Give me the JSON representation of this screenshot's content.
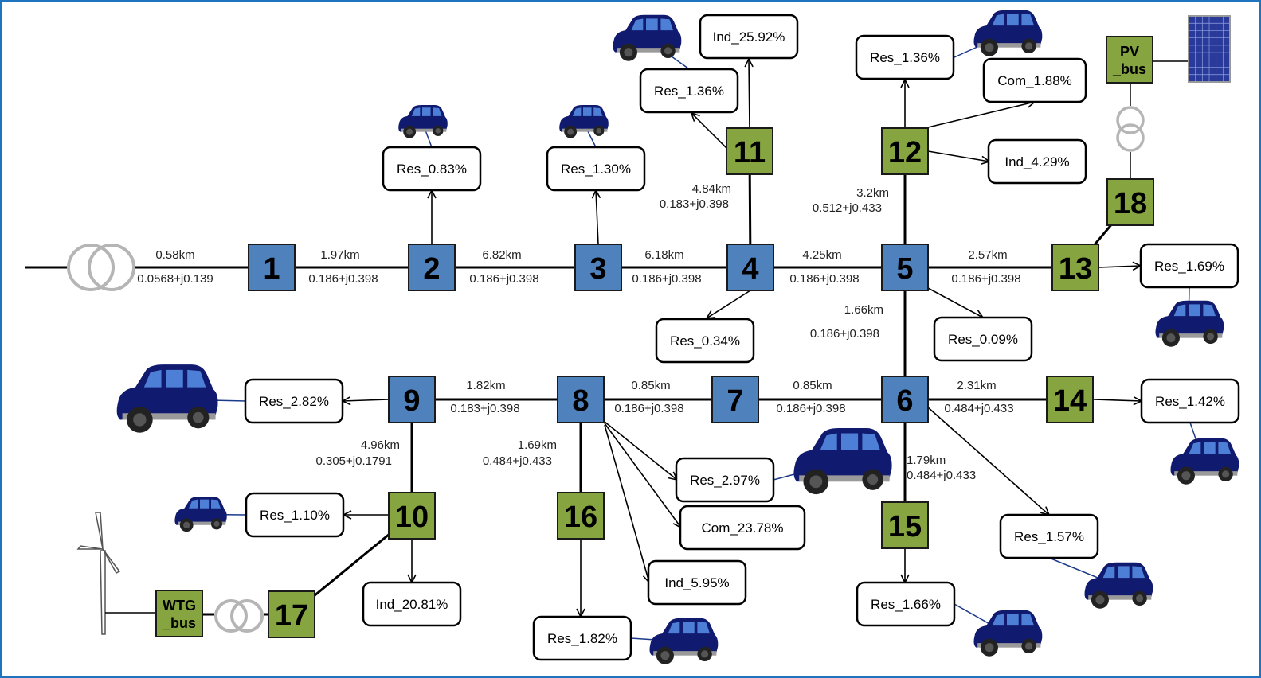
{
  "colors": {
    "distribution_bus": "#4f81bd",
    "der_bus": "#86a43f",
    "frame": "#1f74bf",
    "transformer": "#b5b5b5",
    "ev": "#101a6e"
  },
  "buses": [
    {
      "id": "1",
      "type": "distribution"
    },
    {
      "id": "2",
      "type": "distribution"
    },
    {
      "id": "3",
      "type": "distribution"
    },
    {
      "id": "4",
      "type": "distribution"
    },
    {
      "id": "5",
      "type": "distribution"
    },
    {
      "id": "6",
      "type": "distribution"
    },
    {
      "id": "7",
      "type": "distribution"
    },
    {
      "id": "8",
      "type": "distribution"
    },
    {
      "id": "9",
      "type": "distribution"
    },
    {
      "id": "10",
      "type": "der"
    },
    {
      "id": "11",
      "type": "der"
    },
    {
      "id": "12",
      "type": "der"
    },
    {
      "id": "13",
      "type": "der"
    },
    {
      "id": "14",
      "type": "der"
    },
    {
      "id": "15",
      "type": "der"
    },
    {
      "id": "16",
      "type": "der"
    },
    {
      "id": "17",
      "type": "der"
    },
    {
      "id": "18",
      "type": "der"
    }
  ],
  "special_buses": {
    "wtg": [
      "WTG",
      "_bus"
    ],
    "pv": [
      "PV",
      "_bus"
    ]
  },
  "loads": [
    {
      "bus": "2",
      "label": "Res_0.83%",
      "ev": true
    },
    {
      "bus": "3",
      "label": "Res_1.30%",
      "ev": true
    },
    {
      "bus": "11",
      "label": "Res_1.36%",
      "ev": true
    },
    {
      "bus": "11",
      "label": "Ind_25.92%",
      "ev": false
    },
    {
      "bus": "12",
      "label": "Res_1.36%",
      "ev": true
    },
    {
      "bus": "12",
      "label": "Com_1.88%",
      "ev": false
    },
    {
      "bus": "12",
      "label": "Ind_4.29%",
      "ev": false
    },
    {
      "bus": "13",
      "label": "Res_1.69%",
      "ev": true
    },
    {
      "bus": "4",
      "label": "Res_0.34%",
      "ev": false
    },
    {
      "bus": "5",
      "label": "Res_0.09%",
      "ev": false
    },
    {
      "bus": "9",
      "label": "Res_2.82%",
      "ev": true
    },
    {
      "bus": "14",
      "label": "Res_1.42%",
      "ev": true
    },
    {
      "bus": "8",
      "label": "Res_2.97%",
      "ev": true
    },
    {
      "bus": "8",
      "label": "Com_23.78%",
      "ev": false
    },
    {
      "bus": "8",
      "label": "Ind_5.95%",
      "ev": false
    },
    {
      "bus": "10",
      "label": "Res_1.10%",
      "ev": true
    },
    {
      "bus": "10",
      "label": "Ind_20.81%",
      "ev": false
    },
    {
      "bus": "16",
      "label": "Res_1.82%",
      "ev": true
    },
    {
      "bus": "15",
      "label": "Res_1.66%",
      "ev": true
    },
    {
      "bus": "6",
      "label": "Res_1.57%",
      "ev": true
    }
  ],
  "lines": [
    {
      "from": "source",
      "to": "1",
      "length": "0.58km",
      "impedance": "0.0568+j0.139"
    },
    {
      "from": "1",
      "to": "2",
      "length": "1.97km",
      "impedance": "0.186+j0.398"
    },
    {
      "from": "2",
      "to": "3",
      "length": "6.82km",
      "impedance": "0.186+j0.398"
    },
    {
      "from": "3",
      "to": "4",
      "length": "6.18km",
      "impedance": "0.186+j0.398"
    },
    {
      "from": "4",
      "to": "5",
      "length": "4.25km",
      "impedance": "0.186+j0.398"
    },
    {
      "from": "5",
      "to": "13",
      "length": "2.57km",
      "impedance": "0.186+j0.398"
    },
    {
      "from": "4",
      "to": "11",
      "length": "4.84km",
      "impedance": "0.183+j0.398"
    },
    {
      "from": "5",
      "to": "12",
      "length": "3.2km",
      "impedance": "0.512+j0.433"
    },
    {
      "from": "5",
      "to": "6",
      "length": "1.66km",
      "impedance": "0.186+j0.398"
    },
    {
      "from": "8",
      "to": "9",
      "length": "1.82km",
      "impedance": "0.183+j0.398"
    },
    {
      "from": "7",
      "to": "8",
      "length": "0.85km",
      "impedance": "0.186+j0.398"
    },
    {
      "from": "6",
      "to": "7",
      "length": "0.85km",
      "impedance": "0.186+j0.398"
    },
    {
      "from": "6",
      "to": "14",
      "length": "2.31km",
      "impedance": "0.484+j0.433"
    },
    {
      "from": "9",
      "to": "10",
      "length": "4.96km",
      "impedance": "0.305+j0.1791"
    },
    {
      "from": "8",
      "to": "16",
      "length": "1.69km",
      "impedance": "0.484+j0.433"
    },
    {
      "from": "6",
      "to": "15",
      "length": "1.79km",
      "impedance": "0.484+j0.433"
    }
  ]
}
